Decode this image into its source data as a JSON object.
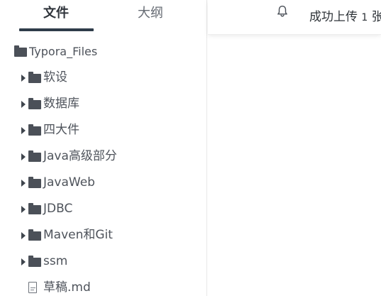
{
  "sidebar": {
    "tabs": [
      {
        "label": "文件"
      },
      {
        "label": "大纲"
      }
    ],
    "root": {
      "label": "Typora_Files"
    },
    "folders": [
      {
        "label": "软设"
      },
      {
        "label": "数据库"
      },
      {
        "label": "四大件"
      },
      {
        "label": "Java高级部分"
      },
      {
        "label": "JavaWeb"
      },
      {
        "label": "JDBC"
      },
      {
        "label": "Maven和Git"
      },
      {
        "label": "ssm"
      }
    ],
    "file": {
      "label": "草稿.md"
    }
  },
  "topbar": {
    "notice_prefix": "成功上传",
    "notice_number": "1",
    "notice_suffix": "张"
  },
  "icons": {
    "bell": "bell-icon",
    "folder": "folder-icon",
    "file": "file-icon",
    "expand": "caret-right-icon"
  }
}
